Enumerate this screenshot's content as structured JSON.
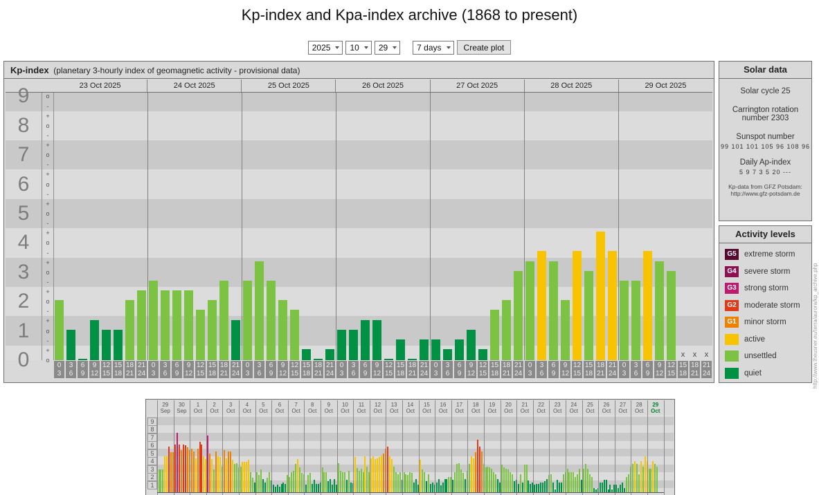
{
  "page": {
    "title": "Kp-index and Kpa-index archive (1868 to present)",
    "watermark": "http://www.theusner.eu/terra/aurora/kp_archive.php"
  },
  "controls": {
    "year": "2025",
    "month": "10",
    "day": "29",
    "range": "7 days",
    "create_button": "Create plot"
  },
  "main_chart_header": {
    "title": "Kp-index",
    "subtitle": "(planetary 3-hourly index of geomagnetic activity - provisional data)"
  },
  "solar_data": {
    "title": "Solar data",
    "cycle": "Solar cycle 25",
    "carrington_1": "Carrington rotation",
    "carrington_2": "number 2303",
    "sunspot_label": "Sunspot number",
    "sunspot_values": "99  101 101 105 96  108 96",
    "ap_label": "Daily Ap-index",
    "ap_values": "5    9    7    3    5    20   ---",
    "source_1": "Kp-data from GFZ Potsdam:",
    "source_2": "http://www.gfz-potsdam.de"
  },
  "activity_levels": {
    "title": "Activity levels",
    "items": [
      {
        "badge": "G5",
        "label": "extreme storm",
        "color": "#56082f"
      },
      {
        "badge": "G4",
        "label": "severe storm",
        "color": "#8e1050"
      },
      {
        "badge": "G3",
        "label": "strong storm",
        "color": "#c2186e"
      },
      {
        "badge": "G2",
        "label": "moderate storm",
        "color": "#e23a18"
      },
      {
        "badge": "G1",
        "label": "minor storm",
        "color": "#ee8100"
      },
      {
        "badge": "",
        "label": "active",
        "color": "#f8c301"
      },
      {
        "badge": "",
        "label": "unsettled",
        "color": "#7cc243"
      },
      {
        "badge": "",
        "label": "quiet",
        "color": "#009144"
      }
    ]
  },
  "colors": {
    "quiet": "#009144",
    "unsettled": "#7cc243",
    "active": "#f8c301",
    "g1": "#ee8100",
    "g2": "#e23a18",
    "g3": "#c2186e",
    "g4": "#8e1050",
    "g5": "#56082f",
    "band_dark": "#c9c9c9",
    "band_light": "#dcdcdc"
  },
  "chart_data": [
    {
      "type": "bar",
      "title": "Kp-index 23-29 Oct 2025",
      "ylabel": "Kp",
      "ylim": [
        0,
        9
      ],
      "grid": "horizontal bands per Kp unit",
      "missing_marker": "x",
      "y_axis_numbers": [
        9,
        8,
        7,
        6,
        5,
        4,
        3,
        2,
        1,
        0
      ],
      "sub_tick_symbols": [
        "+",
        "o",
        "-"
      ],
      "hour_slots": [
        [
          "0",
          "3"
        ],
        [
          "3",
          "6"
        ],
        [
          "6",
          "9"
        ],
        [
          "9",
          "12"
        ],
        [
          "12",
          "15"
        ],
        [
          "15",
          "18"
        ],
        [
          "18",
          "21"
        ],
        [
          "21",
          "24"
        ]
      ],
      "days": [
        {
          "date": "23 Oct 2025",
          "kp_labels": [
            "2o",
            "1o",
            "0o",
            "1+",
            "1o",
            "1o",
            "2o",
            "2+"
          ],
          "values": [
            2,
            1,
            0,
            1.33,
            1,
            1,
            2,
            2.33
          ]
        },
        {
          "date": "24 Oct 2025",
          "kp_labels": [
            "3-",
            "2+",
            "2+",
            "2+",
            "2-",
            "2o",
            "3-",
            "1+"
          ],
          "values": [
            2.67,
            2.33,
            2.33,
            2.33,
            1.67,
            2,
            2.67,
            1.33
          ]
        },
        {
          "date": "25 Oct 2025",
          "kp_labels": [
            "3-",
            "3+",
            "3-",
            "2o",
            "2-",
            "0+",
            "0o",
            "0+"
          ],
          "values": [
            2.67,
            3.33,
            2.67,
            2,
            1.67,
            0.33,
            0,
            0.33
          ]
        },
        {
          "date": "26 Oct 2025",
          "kp_labels": [
            "1o",
            "1o",
            "1+",
            "1+",
            "0o",
            "1-",
            "0o",
            "1-"
          ],
          "values": [
            1,
            1,
            1.33,
            1.33,
            0,
            0.67,
            0,
            0.67
          ]
        },
        {
          "date": "27 Oct 2025",
          "kp_labels": [
            "1-",
            "0+",
            "1-",
            "1o",
            "0+",
            "2-",
            "2o",
            "3o"
          ],
          "values": [
            0.67,
            0.33,
            0.67,
            1,
            0.33,
            1.67,
            2,
            3
          ]
        },
        {
          "date": "28 Oct 2025",
          "kp_labels": [
            "3+",
            "4-",
            "3+",
            "2o",
            "4-",
            "3o",
            "4+",
            "4-"
          ],
          "values": [
            3.33,
            3.67,
            3.33,
            2,
            3.67,
            3,
            4.33,
            3.67
          ]
        },
        {
          "date": "29 Oct 2025",
          "kp_labels": [
            "3-",
            "3-",
            "4-",
            "3+",
            "3o",
            null,
            null,
            null
          ],
          "values": [
            2.67,
            2.67,
            3.67,
            3.33,
            3,
            null,
            null,
            null
          ]
        }
      ]
    },
    {
      "type": "bar",
      "title": "Kp overview 29 Sep - 29 Oct 2025 (8 bars per day)",
      "ylim": [
        0,
        9
      ],
      "y_axis_numbers": [
        9,
        8,
        7,
        6,
        5,
        4,
        3,
        2,
        1
      ],
      "selected_day": "29 Oct",
      "days": [
        {
          "d": "29",
          "m": "Sep",
          "values": [
            2.6,
            2.6,
            2.6,
            4.3,
            4.3,
            5.5,
            4.8,
            4.8
          ]
        },
        {
          "d": "30",
          "m": "Sep",
          "values": [
            5.8,
            7.2,
            5.8,
            5.1,
            5.8,
            5.7,
            5.4,
            5.1
          ]
        },
        {
          "d": "1",
          "m": "Oct",
          "values": [
            5.2,
            4.9,
            4.0,
            5.2,
            6.1,
            5.8,
            4.3,
            3.9
          ]
        },
        {
          "d": "2",
          "m": "Oct",
          "values": [
            6.9,
            4.6,
            3.9,
            2.6,
            4.9,
            4.3,
            4.2,
            3.0
          ]
        },
        {
          "d": "3",
          "m": "Oct",
          "values": [
            5.1,
            4.0,
            4.9,
            4.9,
            3.8,
            3.3,
            3.4,
            2.9
          ]
        },
        {
          "d": "4",
          "m": "Oct",
          "values": [
            3.0,
            3.6,
            3.6,
            3.6,
            3.8,
            2.3,
            1.6,
            1.0
          ]
        },
        {
          "d": "5",
          "m": "Oct",
          "values": [
            2.3,
            1.9,
            2.6,
            1.4,
            1.0,
            1.6,
            2.3,
            1.2
          ]
        },
        {
          "d": "6",
          "m": "Oct",
          "values": [
            0.7,
            0.4,
            0.7,
            0.4,
            0.8,
            1.0,
            0.8,
            1.9
          ]
        },
        {
          "d": "7",
          "m": "Oct",
          "values": [
            1.7,
            2.3,
            2.4,
            3.3,
            3.9,
            2.9,
            2.2,
            2.0
          ]
        },
        {
          "d": "8",
          "m": "Oct",
          "values": [
            0.7,
            1.9,
            2.2,
            0.8,
            1.3,
            0.8,
            0.8,
            1.0
          ]
        },
        {
          "d": "9",
          "m": "Oct",
          "values": [
            2.9,
            2.3,
            2.3,
            1.1,
            1.4,
            0.7,
            1.4,
            0.7
          ]
        },
        {
          "d": "10",
          "m": "Oct",
          "values": [
            3.4,
            2.4,
            2.3,
            2.3,
            1.3,
            2.4,
            1.0,
            0.9
          ]
        },
        {
          "d": "11",
          "m": "Oct",
          "values": [
            4.2,
            2.8,
            2.4,
            2.7,
            2.3,
            4.3,
            3.0,
            2.3
          ]
        },
        {
          "d": "12",
          "m": "Oct",
          "values": [
            4.0,
            4.3,
            3.9,
            4.0,
            4.2,
            4.4,
            4.6,
            5.2
          ]
        },
        {
          "d": "13",
          "m": "Oct",
          "values": [
            5.5,
            4.3,
            3.9,
            3.0,
            2.3,
            2.0,
            2.3,
            1.3
          ]
        },
        {
          "d": "14",
          "m": "Oct",
          "values": [
            2.3,
            2.0,
            1.9,
            2.3,
            2.2,
            1.0,
            1.4,
            0.7
          ]
        },
        {
          "d": "15",
          "m": "Oct",
          "values": [
            3.8,
            2.6,
            2.3,
            1.1,
            2.0,
            0.8,
            1.0,
            0.7
          ]
        },
        {
          "d": "16",
          "m": "Oct",
          "values": [
            1.0,
            1.4,
            0.6,
            1.0,
            1.4,
            1.4,
            1.7,
            1.7
          ]
        },
        {
          "d": "17",
          "m": "Oct",
          "values": [
            1.3,
            2.3,
            3.3,
            3.4,
            2.6,
            2.2,
            1.4,
            2.4
          ]
        },
        {
          "d": "18",
          "m": "Oct",
          "values": [
            3.3,
            4.3,
            4.0,
            4.8,
            6.4,
            5.5,
            4.9,
            3.3
          ]
        },
        {
          "d": "19",
          "m": "Oct",
          "values": [
            2.9,
            3.0,
            2.9,
            2.7,
            2.3,
            2.0,
            1.4,
            1.0
          ]
        },
        {
          "d": "20",
          "m": "Oct",
          "values": [
            3.2,
            2.9,
            2.7,
            2.6,
            2.3,
            2.0,
            1.1,
            1.3
          ]
        },
        {
          "d": "21",
          "m": "Oct",
          "values": [
            0.8,
            2.0,
            1.0,
            3.2,
            3.2,
            1.2,
            0.8,
            1.0
          ]
        },
        {
          "d": "22",
          "m": "Oct",
          "values": [
            0.7,
            0.8,
            0.8,
            1.0,
            1.0,
            1.1,
            1.4,
            1.9
          ]
        },
        {
          "d": "23",
          "m": "Oct",
          "values": [
            2.0,
            1.0,
            0.1,
            1.3,
            1.0,
            1.0,
            2.0,
            2.3
          ]
        },
        {
          "d": "24",
          "m": "Oct",
          "values": [
            2.7,
            2.3,
            2.3,
            2.3,
            1.7,
            2.0,
            2.7,
            1.3
          ]
        },
        {
          "d": "25",
          "m": "Oct",
          "values": [
            2.7,
            3.3,
            2.7,
            2.0,
            1.7,
            0.3,
            0.1,
            0.3
          ]
        },
        {
          "d": "26",
          "m": "Oct",
          "values": [
            1.0,
            1.0,
            1.3,
            1.3,
            0.1,
            0.7,
            0.1,
            0.7
          ]
        },
        {
          "d": "27",
          "m": "Oct",
          "values": [
            0.7,
            0.3,
            0.7,
            1.0,
            0.3,
            1.7,
            2.0,
            3.0
          ]
        },
        {
          "d": "28",
          "m": "Oct",
          "values": [
            3.3,
            3.7,
            3.3,
            2.0,
            3.7,
            3.0,
            4.3,
            3.7
          ]
        },
        {
          "d": "29",
          "m": "Oct",
          "current": true,
          "values": [
            2.7,
            2.7,
            3.7,
            3.3,
            3.0,
            null,
            null,
            null
          ]
        }
      ]
    }
  ]
}
